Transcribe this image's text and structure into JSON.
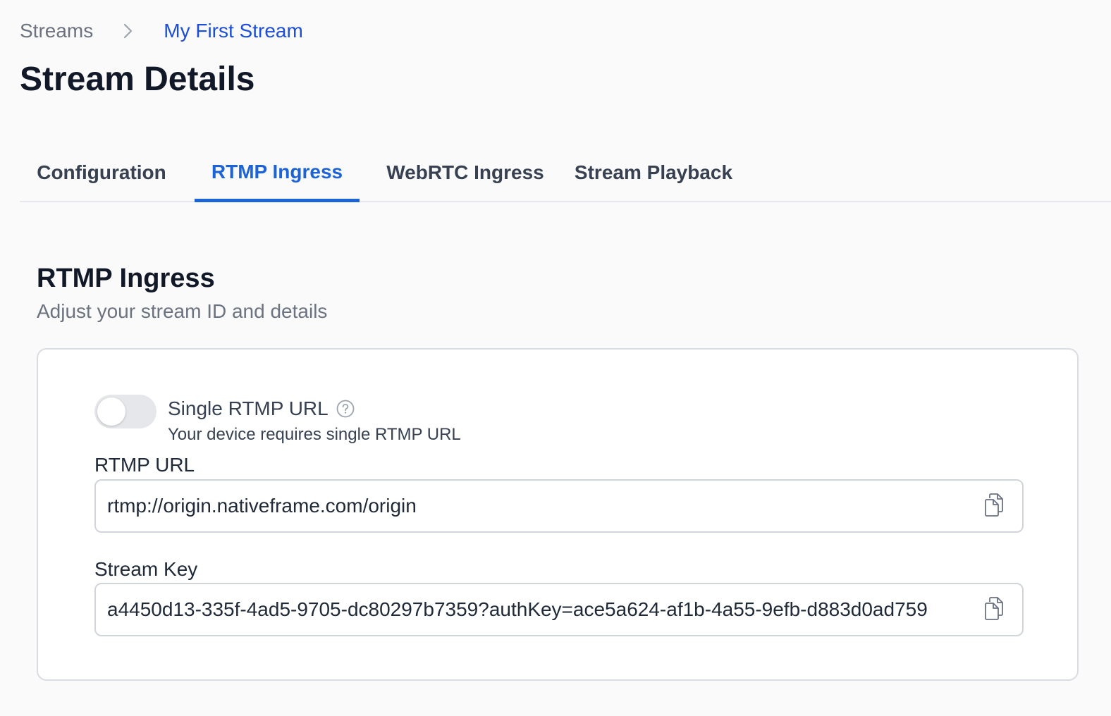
{
  "breadcrumb": {
    "root": "Streams",
    "current": "My First Stream"
  },
  "page": {
    "title": "Stream Details"
  },
  "tabs": [
    {
      "label": "Configuration",
      "active": false
    },
    {
      "label": "RTMP Ingress",
      "active": true
    },
    {
      "label": "WebRTC Ingress",
      "active": false
    },
    {
      "label": "Stream Playback",
      "active": false
    }
  ],
  "section": {
    "title": "RTMP Ingress",
    "subtitle": "Adjust your stream ID and details"
  },
  "single_rtmp": {
    "label": "Single RTMP URL",
    "description": "Your device requires single RTMP URL",
    "enabled": false
  },
  "rtmp_url": {
    "label": "RTMP URL",
    "value": "rtmp://origin.nativeframe.com/origin"
  },
  "stream_key": {
    "label": "Stream Key",
    "value": "a4450d13-335f-4ad5-9705-dc80297b7359?authKey=ace5a624-af1b-4a55-9efb-d883d0ad759"
  },
  "icons": {
    "breadcrumb_separator": "chevron-right-icon",
    "help": "question-circle-icon",
    "copy": "copy-icon"
  },
  "colors": {
    "accent": "#1d63d8",
    "breadcrumb_current": "#1d4ed8",
    "background": "#fafafa",
    "card_border": "#d9dce1"
  }
}
